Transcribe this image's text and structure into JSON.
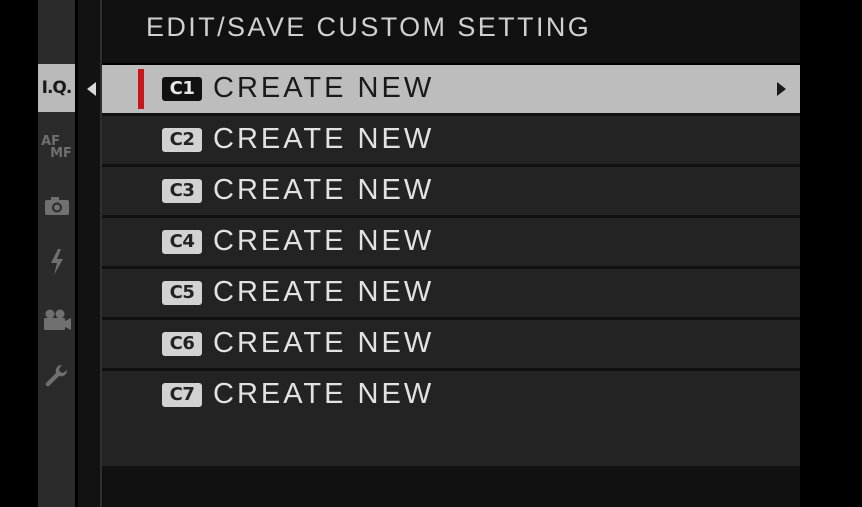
{
  "menu": {
    "title": "EDIT/SAVE CUSTOM SETTING",
    "items": [
      {
        "badge": "C1",
        "label": "CREATE NEW",
        "selected": true
      },
      {
        "badge": "C2",
        "label": "CREATE NEW",
        "selected": false
      },
      {
        "badge": "C3",
        "label": "CREATE NEW",
        "selected": false
      },
      {
        "badge": "C4",
        "label": "CREATE NEW",
        "selected": false
      },
      {
        "badge": "C5",
        "label": "CREATE NEW",
        "selected": false
      },
      {
        "badge": "C6",
        "label": "CREATE NEW",
        "selected": false
      },
      {
        "badge": "C7",
        "label": "CREATE NEW",
        "selected": false
      }
    ]
  },
  "sidebar": {
    "tabs": [
      {
        "label": "I.Q.",
        "icon": "image-quality-icon",
        "active": true
      },
      {
        "label_top": "AF",
        "label_bottom": "MF",
        "icon": "af-mf-icon",
        "active": false
      },
      {
        "icon": "camera-icon",
        "active": false
      },
      {
        "icon": "flash-icon",
        "active": false
      },
      {
        "icon": "movie-camera-icon",
        "active": false
      },
      {
        "icon": "wrench-icon",
        "active": false
      }
    ]
  },
  "colors": {
    "accent": "#c8141c",
    "selected_row": "#bdbdbd",
    "row": "#232323",
    "background": "#000000"
  }
}
